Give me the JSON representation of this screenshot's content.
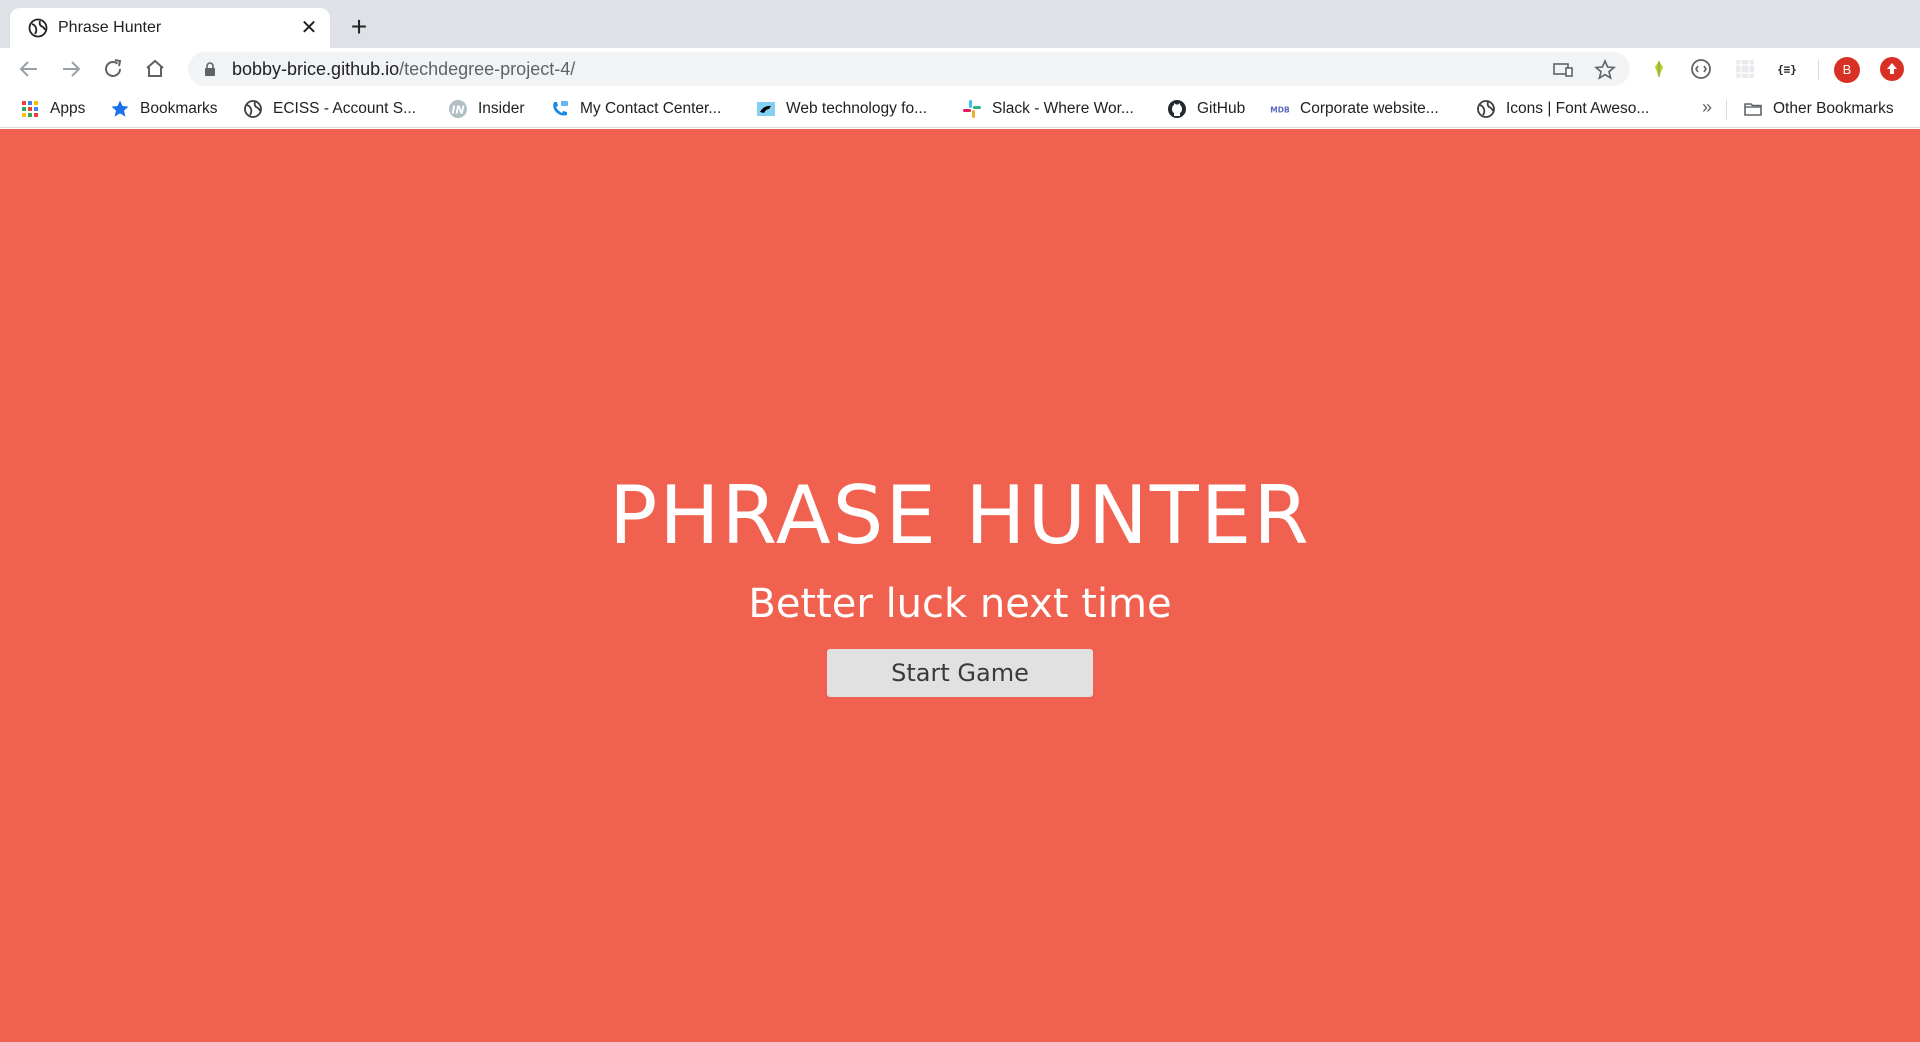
{
  "browser": {
    "tab": {
      "title": "Phrase Hunter"
    },
    "url": {
      "host": "bobby-brice.github.io",
      "path": "/techdegree-project-4/"
    },
    "avatar_initial": "B",
    "bookmarks": [
      {
        "label": "Apps",
        "icon": "apps-grid-icon"
      },
      {
        "label": "Bookmarks",
        "icon": "star-icon"
      },
      {
        "label": "ECISS - Account S...",
        "icon": "globe-icon"
      },
      {
        "label": "Insider",
        "icon": "insider-logo-icon"
      },
      {
        "label": "My Contact Center...",
        "icon": "phone-icon"
      },
      {
        "label": "Web technology fo...",
        "icon": "mdn-icon"
      },
      {
        "label": "Slack - Where Wor...",
        "icon": "slack-icon"
      },
      {
        "label": "GitHub",
        "icon": "github-icon"
      },
      {
        "label": "Corporate website...",
        "icon": "mdb-icon"
      },
      {
        "label": "Icons | Font Aweso...",
        "icon": "globe-icon"
      }
    ],
    "bookmarks_overflow": "»",
    "other_bookmarks": "Other Bookmarks"
  },
  "game": {
    "title": "PHRASE HUNTER",
    "message": "Better luck next time",
    "start_button": "Start Game"
  },
  "colors": {
    "page_background": "#f0624f",
    "button_background": "#e1e1e1",
    "text_on_page": "#ffffff"
  }
}
